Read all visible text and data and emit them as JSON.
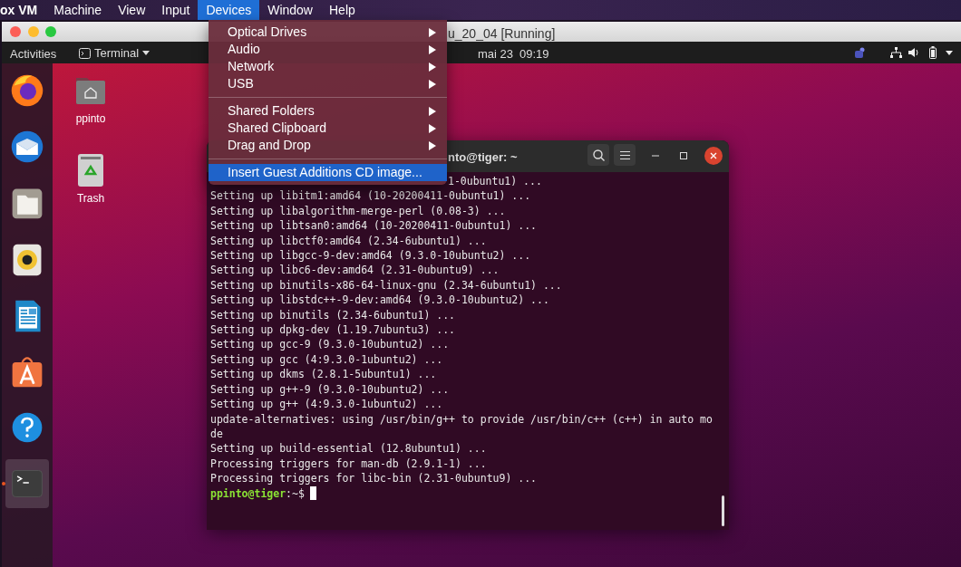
{
  "menu_bar": {
    "items": [
      {
        "label": "ox VM",
        "selected": false,
        "kind": "app"
      },
      {
        "label": "Machine",
        "selected": false,
        "kind": "menu"
      },
      {
        "label": "View",
        "selected": false,
        "kind": "menu"
      },
      {
        "label": "Input",
        "selected": false,
        "kind": "menu"
      },
      {
        "label": "Devices",
        "selected": true,
        "kind": "menu"
      },
      {
        "label": "Window",
        "selected": false,
        "kind": "menu"
      },
      {
        "label": "Help",
        "selected": false,
        "kind": "menu"
      }
    ]
  },
  "devices_menu": {
    "groups": [
      [
        {
          "label": "Optical Drives",
          "submenu": true,
          "selected": false
        },
        {
          "label": "Audio",
          "submenu": true,
          "selected": false
        },
        {
          "label": "Network",
          "submenu": true,
          "selected": false
        },
        {
          "label": "USB",
          "submenu": true,
          "selected": false
        }
      ],
      [
        {
          "label": "Shared Folders",
          "submenu": true,
          "selected": false
        },
        {
          "label": "Shared Clipboard",
          "submenu": true,
          "selected": false
        },
        {
          "label": "Drag and Drop",
          "submenu": true,
          "selected": false
        }
      ],
      [
        {
          "label": "Insert Guest Additions CD image...",
          "submenu": false,
          "selected": true
        }
      ]
    ]
  },
  "vm_window": {
    "title": "u_20_04 [Running]"
  },
  "top_bar": {
    "activities": "Activities",
    "app_menu": "Terminal",
    "date": "mai 23",
    "time": "09:19"
  },
  "desktop_icons": [
    {
      "label": "ppinto",
      "kind": "home"
    },
    {
      "label": "Trash",
      "kind": "trash"
    }
  ],
  "dock": {
    "items": [
      {
        "kind": "browser",
        "selected": false
      },
      {
        "kind": "mail",
        "selected": false
      },
      {
        "kind": "files",
        "selected": false
      },
      {
        "kind": "music",
        "selected": false
      },
      {
        "kind": "writer",
        "selected": false
      },
      {
        "kind": "store",
        "selected": false
      },
      {
        "kind": "help",
        "selected": false
      },
      {
        "kind": "terminal",
        "selected": true
      }
    ]
  },
  "terminal": {
    "title": "nto@tiger: ~",
    "first_line": "1-0ubuntu1) ...",
    "lines": [
      "Setting up libitm1:amd64 (10-20200411-0ubuntu1) ...",
      "Setting up libalgorithm-merge-perl (0.08-3) ...",
      "Setting up libtsan0:amd64 (10-20200411-0ubuntu1) ...",
      "Setting up libctf0:amd64 (2.34-6ubuntu1) ...",
      "Setting up libgcc-9-dev:amd64 (9.3.0-10ubuntu2) ...",
      "Setting up libc6-dev:amd64 (2.31-0ubuntu9) ...",
      "Setting up binutils-x86-64-linux-gnu (2.34-6ubuntu1) ...",
      "Setting up libstdc++-9-dev:amd64 (9.3.0-10ubuntu2) ...",
      "Setting up binutils (2.34-6ubuntu1) ...",
      "Setting up dpkg-dev (1.19.7ubuntu3) ...",
      "Setting up gcc-9 (9.3.0-10ubuntu2) ...",
      "Setting up gcc (4:9.3.0-1ubuntu2) ...",
      "Setting up dkms (2.8.1-5ubuntu1) ...",
      "Setting up g++-9 (9.3.0-10ubuntu2) ...",
      "Setting up g++ (4:9.3.0-1ubuntu2) ...",
      "update-alternatives: using /usr/bin/g++ to provide /usr/bin/c++ (c++) in auto mo",
      "de",
      "Setting up build-essential (12.8ubuntu1) ...",
      "Processing triggers for man-db (2.9.1-1) ...",
      "Processing triggers for libc-bin (2.31-0ubuntu9) ..."
    ],
    "prompt_user": "ppinto@tiger",
    "prompt_path": ":~$"
  }
}
